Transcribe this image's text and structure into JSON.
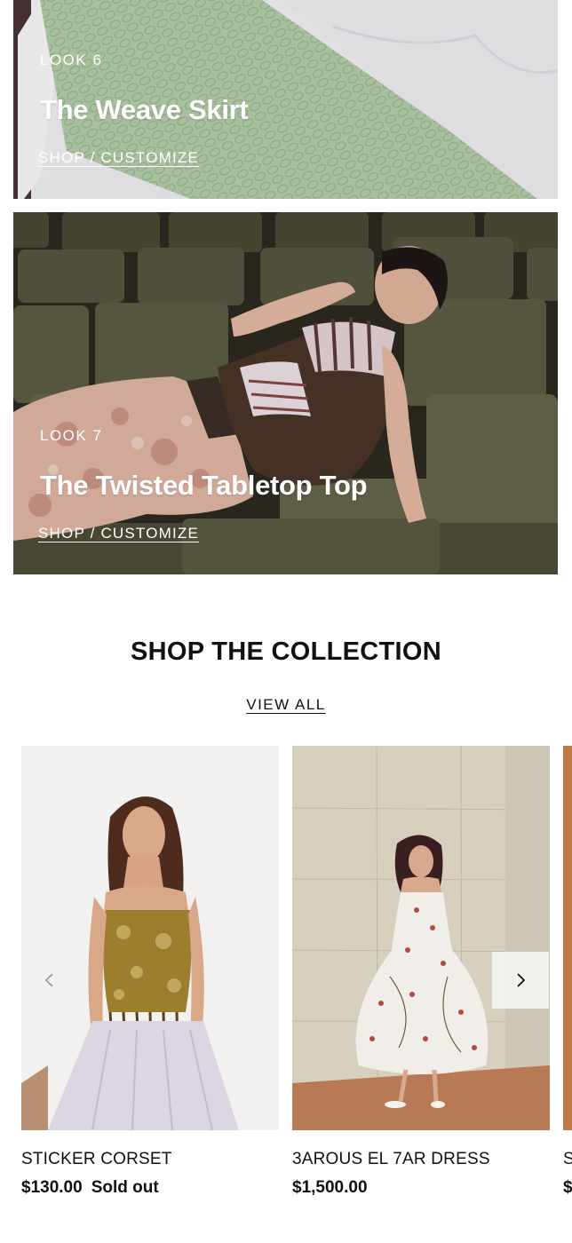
{
  "looks": [
    {
      "label": "LOOK 6",
      "title": "The Weave Skirt",
      "cta": "SHOP / CUSTOMIZE"
    },
    {
      "label": "LOOK 7",
      "title": "The Twisted Tabletop Top",
      "cta": "SHOP / CUSTOMIZE"
    }
  ],
  "collection": {
    "title": "SHOP THE COLLECTION",
    "view_all": "VIEW ALL"
  },
  "products": [
    {
      "name": "STICKER CORSET",
      "price": "$130.00",
      "badge": "Sold out"
    },
    {
      "name": "3AROUS EL 7AR DRESS",
      "price": "$1,500.00"
    },
    {
      "name": "S",
      "price": "$"
    }
  ],
  "icons": {
    "prev": "chevron-left-icon",
    "next": "chevron-right-icon"
  },
  "colors": {
    "text": "#111111",
    "background": "#ffffff",
    "overlay_text": "#ffffff"
  }
}
